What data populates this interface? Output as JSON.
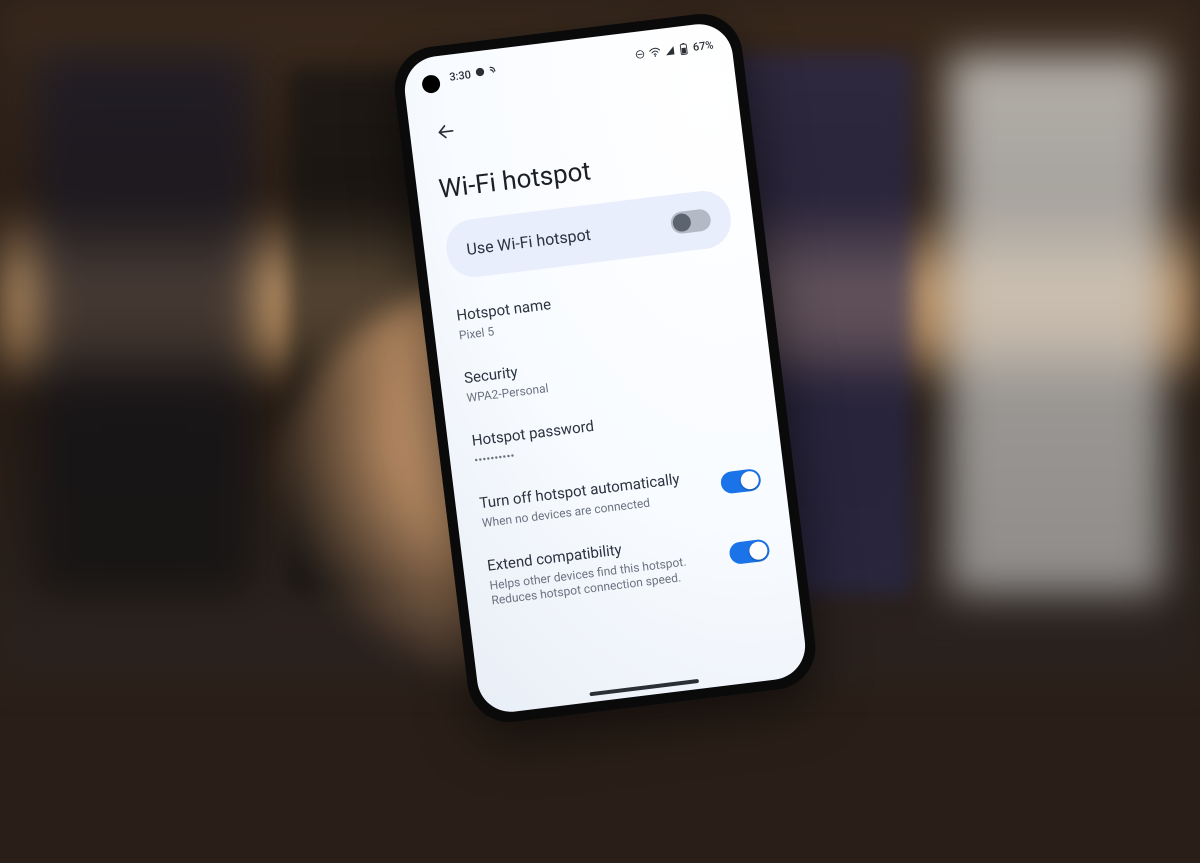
{
  "statusbar": {
    "time": "3:30",
    "battery_text": "67%"
  },
  "screen": {
    "title": "Wi-Fi hotspot",
    "main_toggle": {
      "label": "Use Wi-Fi hotspot",
      "on": false
    },
    "rows": {
      "name": {
        "title": "Hotspot name",
        "value": "Pixel 5"
      },
      "security": {
        "title": "Security",
        "value": "WPA2-Personal"
      },
      "password": {
        "title": "Hotspot password",
        "value": "••••••••••"
      },
      "auto_off": {
        "title": "Turn off hotspot automatically",
        "subtitle": "When no devices are connected",
        "on": true
      },
      "compat": {
        "title": "Extend compatibility",
        "subtitle": "Helps other devices find this hotspot. Reduces hotspot connection speed.",
        "on": true
      }
    }
  }
}
